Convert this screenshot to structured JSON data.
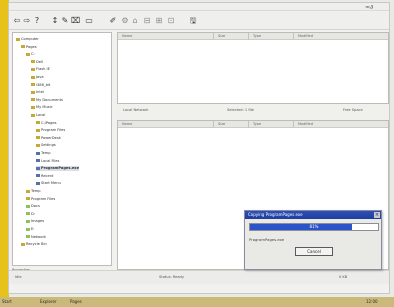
{
  "toolbar": {
    "buttons": [
      {
        "name": "back-arrow-icon",
        "glyph": "⇦"
      },
      {
        "name": "forward-icon",
        "glyph": "⇨"
      },
      {
        "name": "help-icon",
        "glyph": "?"
      },
      {
        "name": "step-icon",
        "glyph": "↕"
      },
      {
        "name": "tool-icon-a",
        "glyph": "✎"
      },
      {
        "name": "tool-icon-b",
        "glyph": "⌧"
      },
      {
        "name": "tool-icon-c",
        "glyph": "▭"
      },
      {
        "name": "edit-icon",
        "glyph": "✐"
      },
      {
        "name": "tool-icon-d",
        "glyph": "⚙"
      },
      {
        "name": "tool-icon-e",
        "glyph": "⌂"
      },
      {
        "name": "tool-icon-f",
        "glyph": "⊟"
      },
      {
        "name": "tool-icon-g",
        "glyph": "⊞"
      },
      {
        "name": "tool-icon-h",
        "glyph": "⊡"
      },
      {
        "name": "save-icon",
        "glyph": "🖫"
      }
    ],
    "logo": "≈∂"
  },
  "tree": {
    "items": [
      {
        "label": "Computer",
        "depth": 0,
        "kind": "root"
      },
      {
        "label": "Pages",
        "depth": 1,
        "kind": "folder"
      },
      {
        "label": "C:",
        "depth": 2,
        "kind": "folder"
      },
      {
        "label": "Dell",
        "depth": 3,
        "kind": "folder"
      },
      {
        "label": "Flash IE",
        "depth": 3,
        "kind": "folder"
      },
      {
        "label": "Java",
        "depth": 3,
        "kind": "folder"
      },
      {
        "label": "i386_bit",
        "depth": 3,
        "kind": "folder"
      },
      {
        "label": "Intel",
        "depth": 3,
        "kind": "folder"
      },
      {
        "label": "My Documents",
        "depth": 3,
        "kind": "folder"
      },
      {
        "label": "My Music",
        "depth": 3,
        "kind": "folder"
      },
      {
        "label": "Local",
        "depth": 3,
        "kind": "folder"
      },
      {
        "label": "C:/Pages",
        "depth": 4,
        "kind": "folder"
      },
      {
        "label": "Program Files",
        "depth": 4,
        "kind": "folder",
        "selected": false
      },
      {
        "label": "PowerDesk",
        "depth": 4,
        "kind": "folder"
      },
      {
        "label": "Settings",
        "depth": 4,
        "kind": "folder"
      },
      {
        "label": "Temp",
        "depth": 4,
        "kind": "blue"
      },
      {
        "label": "Local Files",
        "depth": 4,
        "kind": "blue"
      },
      {
        "label": "ProgramPages.exe",
        "depth": 4,
        "kind": "blue",
        "selected": true
      },
      {
        "label": "Recent",
        "depth": 4,
        "kind": "blue"
      },
      {
        "label": "Start Menu",
        "depth": 4,
        "kind": "blue"
      },
      {
        "label": "Temp",
        "depth": 2,
        "kind": "folder"
      },
      {
        "label": "Program Files",
        "depth": 2,
        "kind": "folder"
      },
      {
        "label": "Docs",
        "depth": 2,
        "kind": "green"
      },
      {
        "label": "D:",
        "depth": 2,
        "kind": "green"
      },
      {
        "label": "Images",
        "depth": 2,
        "kind": "green"
      },
      {
        "label": "E:",
        "depth": 2,
        "kind": "green"
      },
      {
        "label": "Network",
        "depth": 2,
        "kind": "green"
      },
      {
        "label": "Recycle Bin",
        "depth": 1,
        "kind": "folder"
      }
    ],
    "footer": "Properties"
  },
  "top_panel": {
    "columns": [
      "Name",
      "Size",
      "Type",
      "Modified"
    ]
  },
  "mid_strip": {
    "left": "Local Network",
    "middle": "Selected: 1 file",
    "right": "Free Space"
  },
  "bottom_panel": {
    "columns": [
      "Name",
      "Size",
      "Type",
      "Modified"
    ]
  },
  "status": {
    "left": "Idle",
    "middle": "Status: Ready",
    "right": "0 KB"
  },
  "dialog": {
    "title": "Copying ProgramPages.exe",
    "close_glyph": "×",
    "progress": 0.8,
    "progress_label": "81%",
    "detail": "ProgramPages.exe",
    "button": "Cancel"
  },
  "taskbar": {
    "start": "Start",
    "items": [
      "Explorer",
      "Pages"
    ],
    "clock": "12:00"
  }
}
